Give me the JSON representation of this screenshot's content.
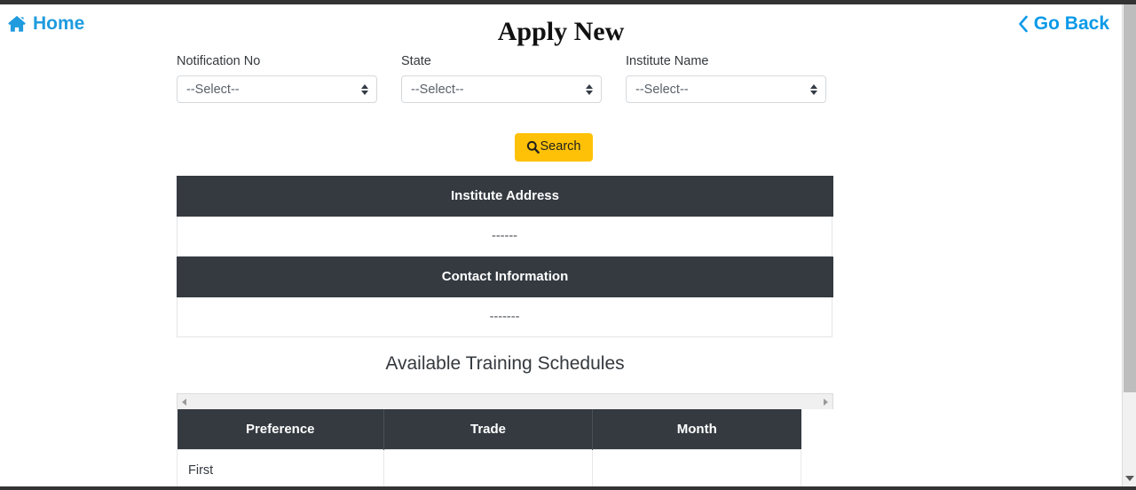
{
  "header": {
    "home_label": "Home",
    "home_icon": "home-icon",
    "title": "Apply New",
    "go_back_label": "Go Back",
    "go_back_icon": "chevron-left-icon"
  },
  "form": {
    "fields": [
      {
        "label": "Notification No",
        "value": "--Select--"
      },
      {
        "label": "State",
        "value": "--Select--"
      },
      {
        "label": "Institute Name",
        "value": "--Select--"
      }
    ],
    "search_label": "Search",
    "search_icon": "search-icon"
  },
  "info": {
    "address_header": "Institute Address",
    "address_value": "------",
    "contact_header": "Contact Information",
    "contact_value": "-------"
  },
  "schedules": {
    "title": "Available Training Schedules",
    "columns": [
      "Preference",
      "Trade",
      "Month"
    ],
    "rows": [
      {
        "preference": "First",
        "trade": "",
        "month": ""
      }
    ]
  },
  "colors": {
    "accent_blue": "#1f9bde",
    "warning_amber": "#ffc107",
    "header_dark": "#343a40"
  }
}
